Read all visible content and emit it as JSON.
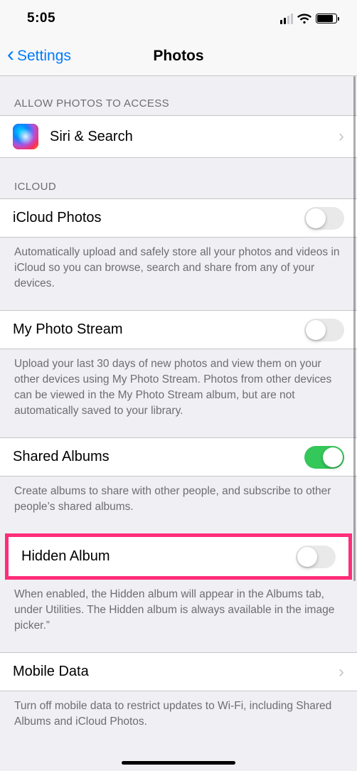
{
  "status": {
    "time": "5:05"
  },
  "nav": {
    "back_label": "Settings",
    "title": "Photos"
  },
  "sections": {
    "access": {
      "header": "ALLOW PHOTOS TO ACCESS",
      "siri_label": "Siri & Search"
    },
    "icloud": {
      "header": "ICLOUD",
      "icloud_photos": {
        "label": "iCloud Photos",
        "on": false
      },
      "icloud_photos_footer": "Automatically upload and safely store all your photos and videos in iCloud so you can browse, search and share from any of your devices.",
      "photo_stream": {
        "label": "My Photo Stream",
        "on": false
      },
      "photo_stream_footer": "Upload your last 30 days of new photos and view them on your other devices using My Photo Stream. Photos from other devices can be viewed in the My Photo Stream album, but are not automatically saved to your library.",
      "shared_albums": {
        "label": "Shared Albums",
        "on": true
      },
      "shared_albums_footer": "Create albums to share with other people, and subscribe to other people’s shared albums.",
      "hidden_album": {
        "label": "Hidden Album",
        "on": false
      },
      "hidden_album_footer": "When enabled, the Hidden album will appear in the Albums tab, under Utilities. The Hidden album is always available in the image picker.”",
      "mobile_data": {
        "label": "Mobile Data"
      },
      "mobile_data_footer": "Turn off mobile data to restrict updates to Wi-Fi, including Shared Albums and iCloud Photos."
    }
  },
  "colors": {
    "accent": "#007aff",
    "toggle_on": "#34c759",
    "highlight": "#ff2d7a"
  }
}
